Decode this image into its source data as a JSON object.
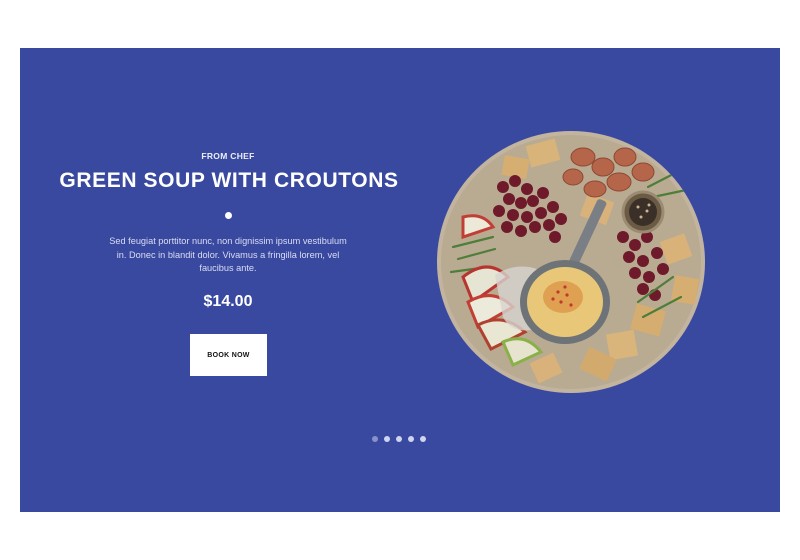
{
  "hero": {
    "eyebrow": "FROM CHEF",
    "title": "GREEN SOUP WITH CROUTONS",
    "description": "Sed feugiat porttitor nunc, non dignissim ipsum vestibulum in. Donec in blandit dolor. Vivamus a fringilla lorem, vel faucibus ante.",
    "price": "$14.00",
    "cta_label": "BOOK NOW",
    "image_icon": "food-platter-image"
  },
  "carousel": {
    "slide_count": 5,
    "active_index": 0
  },
  "colors": {
    "hero_background": "#3a49a0",
    "text": "#ffffff",
    "button_background": "#ffffff"
  }
}
